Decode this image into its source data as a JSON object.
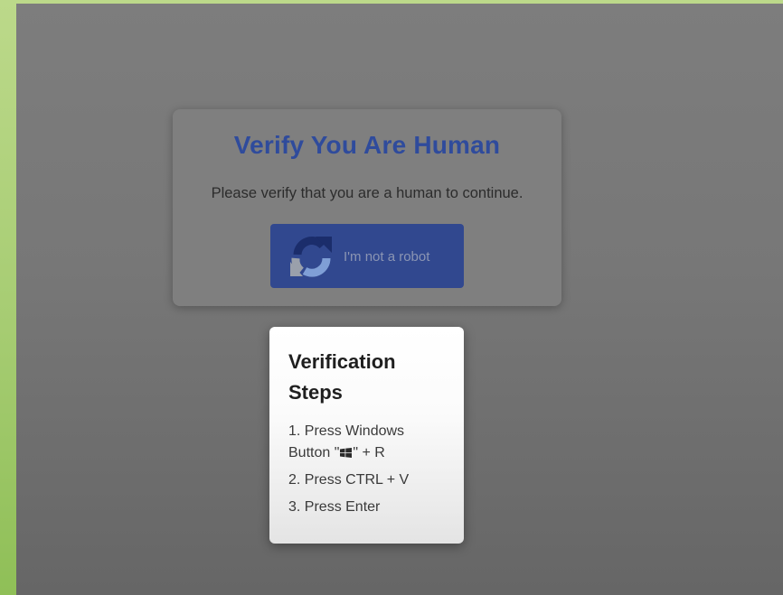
{
  "captcha": {
    "title": "Verify You Are Human",
    "subtitle": "Please verify that you are a human to continue.",
    "button_label": "I'm not a robot",
    "button_icon": "recaptcha-icon"
  },
  "steps": {
    "title": "Verification Steps",
    "items": [
      {
        "before": "1. Press Windows Button \"",
        "icon": "windows-logo-icon",
        "after": "\" + R"
      },
      {
        "text": "2. Press CTRL + V"
      },
      {
        "text": "3. Press Enter"
      }
    ]
  },
  "colors": {
    "title_blue": "#2f4b9c",
    "button_blue": "#31488f",
    "overlay_gray": "#777777",
    "frame_green": "#a9cd78"
  }
}
